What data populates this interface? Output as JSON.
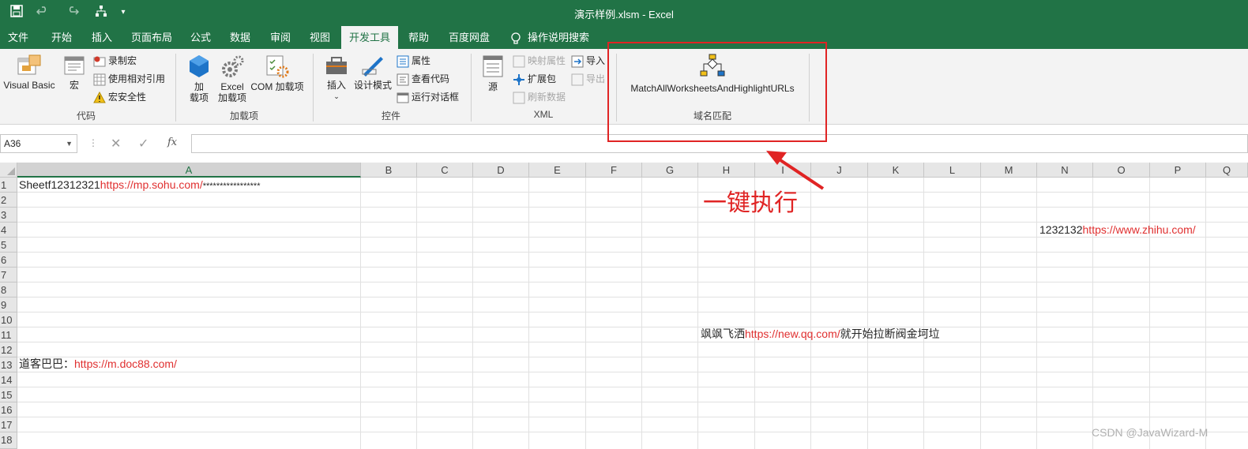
{
  "window": {
    "title": "演示样例.xlsm  -  Excel"
  },
  "quick_access": {
    "icons": [
      "save-icon",
      "undo-icon",
      "redo-icon",
      "share-icon",
      "customize-icon"
    ]
  },
  "tabs": [
    {
      "label": "文件"
    },
    {
      "label": "开始"
    },
    {
      "label": "插入"
    },
    {
      "label": "页面布局"
    },
    {
      "label": "公式"
    },
    {
      "label": "数据"
    },
    {
      "label": "审阅"
    },
    {
      "label": "视图"
    },
    {
      "label": "开发工具"
    },
    {
      "label": "帮助"
    },
    {
      "label": "百度网盘"
    }
  ],
  "active_tab": "开发工具",
  "tell_me": {
    "label": "操作说明搜索"
  },
  "ribbon": {
    "code": {
      "group_label": "代码",
      "visual_basic": "Visual Basic",
      "macros": "宏",
      "record_macro": "录制宏",
      "relative_ref": "使用相对引用",
      "macro_security": "宏安全性"
    },
    "addins": {
      "group_label": "加载项",
      "addins_1": "加",
      "addins_2": "载项",
      "excel_addins_1": "Excel",
      "excel_addins_2": "加载项",
      "com_addins": "COM 加载项"
    },
    "controls": {
      "group_label": "控件",
      "insert": "插入",
      "design_mode": "设计模式",
      "properties": "属性",
      "view_code": "查看代码",
      "run_dialog": "运行对话框"
    },
    "xml": {
      "group_label": "XML",
      "source": "源",
      "map_properties": "映射属性",
      "expansion_packs": "扩展包",
      "refresh_data": "刷新数据",
      "import": "导入",
      "export": "导出"
    },
    "domain": {
      "group_label": "域名匹配",
      "macro_button": "MatchAllWorksheetsAndHighlightURLs"
    }
  },
  "formula_bar": {
    "name_box": "A36",
    "formula": ""
  },
  "columns": [
    "A",
    "B",
    "C",
    "D",
    "E",
    "F",
    "G",
    "H",
    "I",
    "J",
    "K",
    "L",
    "M",
    "N",
    "O",
    "P",
    "Q"
  ],
  "rows": [
    "1",
    "2",
    "3",
    "4",
    "5",
    "6",
    "7",
    "8",
    "9",
    "10",
    "11",
    "12",
    "13",
    "14",
    "15",
    "16",
    "17",
    "18"
  ],
  "cells": {
    "r1_prefix": "Sheetf12312321",
    "r1_url": "https://mp.sohu.com/",
    "r1_suffix": "*****************",
    "r4_prefix": "1232132",
    "r4_url": "https://www.zhihu.com/",
    "r11_prefix": "飒飒飞洒",
    "r11_url": "https://new.qq.com/",
    "r11_suffix": "就开始拉断阀金坷垃",
    "r13_prefix": "道客巴巴：",
    "r13_url": "https://m.doc88.com/"
  },
  "annotation": {
    "text": "一键执行"
  },
  "watermark": "CSDN @JavaWizard-M",
  "colors": {
    "excel_green": "#217346",
    "annotation_red": "#e02424",
    "url_red": "#e03030"
  }
}
